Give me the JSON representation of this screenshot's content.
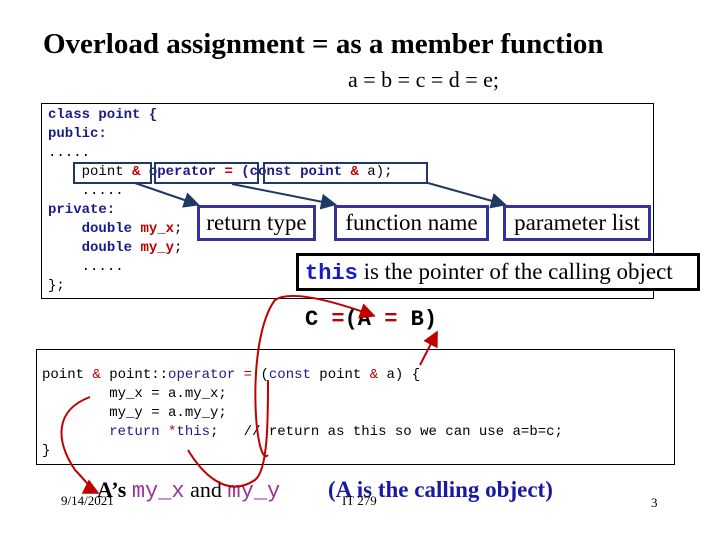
{
  "slide": {
    "title": "Overload assignment = as a member function",
    "subtitle": "a = b = c = d = e;",
    "class_code": {
      "line1": "class point {",
      "line2": "public:",
      "line3": ".....",
      "decl_return": "point",
      "decl_amp": "&",
      "decl_op": "operator",
      "decl_eq": "=",
      "decl_params_pre": "(const point ",
      "decl_params_amp": "&",
      "decl_params_post": " a)",
      "decl_semi": ";",
      "line5": ".....",
      "line6": "private:",
      "line7_type": "double",
      "line7_var": "my_x",
      "line8_type": "double",
      "line8_var": "my_y",
      "line9": ".....",
      "line10": "};"
    },
    "labels": {
      "return_type": "return type",
      "function_name": "function name",
      "parameter_list": "parameter list"
    },
    "this_note": {
      "keyword": "this",
      "text": " is the pointer of the calling object"
    },
    "expression": {
      "c": "C ",
      "eq1": "=",
      "open": "(A ",
      "eq2": "=",
      "close": " B)"
    },
    "impl_code": {
      "l1_a": "point ",
      "l1_amp": "&",
      "l1_b": " point::",
      "l1_op": "operator",
      "l1_sp": " ",
      "l1_eq": "=",
      "l1_c": " (",
      "l1_const": "const",
      "l1_d": " point ",
      "l1_amp2": "&",
      "l1_e": " a) {",
      "l2": "        my_x = a.my_x;",
      "l3": "        my_y = a.my_y;",
      "l4_ind": "        ",
      "l4_ret": "return",
      "l4_sp": " ",
      "l4_star": "*",
      "l4_this": "this",
      "l4_semi": ";   ",
      "l4_comment": "// return as this so we can use a=b=c;",
      "l5": "}"
    },
    "bottom": {
      "a_s": "A’s ",
      "my_x": "my_x",
      "and": " and ",
      "my_y": "my_y",
      "calling": "(A is the calling object)"
    },
    "footer": {
      "date": "9/14/2021",
      "course": "IT 279",
      "page": "3"
    }
  },
  "colors": {
    "keyword": "#1a1a8c",
    "operator_red": "#c00000",
    "label_border": "#333399",
    "arrow_red": "#c00000",
    "arrow_navy": "#1f3864",
    "purple": "#993399",
    "calling_blue": "#1a1aa0"
  }
}
